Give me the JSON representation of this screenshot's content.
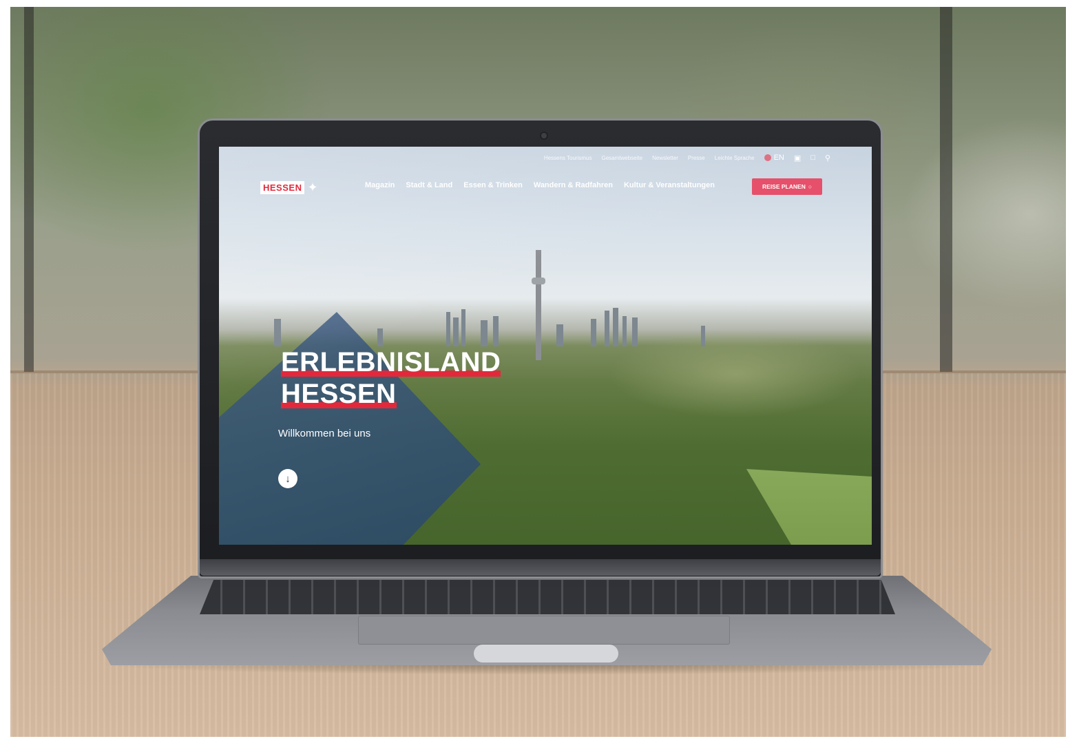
{
  "website": {
    "utility_nav": [
      "Hessens Tourismus",
      "Gesamtwebseite",
      "Newsletter",
      "Presse",
      "Leichte Sprache"
    ],
    "language": "EN",
    "logo_text": "HESSEN",
    "main_nav": [
      "Magazin",
      "Stadt & Land",
      "Essen & Trinken",
      "Wandern & Radfahren",
      "Kultur & Veranstaltungen"
    ],
    "cta_label": "REISE PLANEN",
    "hero": {
      "title_line_1": "ERLEBNISLAND",
      "title_line_2": "HESSEN",
      "subtitle": "Willkommen bei uns",
      "scroll_icon": "arrow-down-icon"
    },
    "icons": [
      "map-icon",
      "bookmark-icon",
      "search-icon"
    ]
  },
  "colors": {
    "brand_red": "#e4283b",
    "cta_pink": "#e6506a",
    "hero_overlay_blue": "#3c5a82"
  }
}
